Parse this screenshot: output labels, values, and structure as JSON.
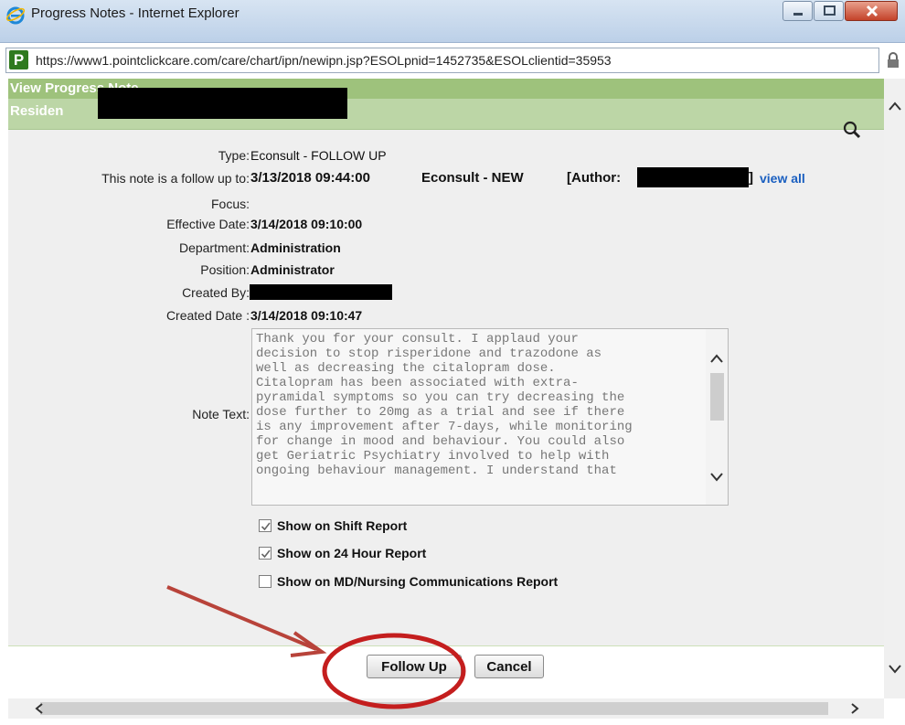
{
  "window": {
    "title": "Progress Notes - Internet Explorer",
    "url": "https://www1.pointclickcare.com/care/chart/ipn/newipn.jsp?ESOLpnid=1452735&ESOLclientid=35953"
  },
  "pane": {
    "title": "View Progress Note",
    "resident_label": "Residen"
  },
  "note": {
    "type_label": "Type:",
    "type_value": "Econsult - FOLLOW UP",
    "followup_label": "This note is a follow up to:",
    "followup_date": "3/13/2018 09:44:00",
    "followup_type": "Econsult - NEW",
    "author_label": "[Author:",
    "author_close": "]",
    "view_all": "view all",
    "focus_label": "Focus:",
    "effective_label": "Effective Date:",
    "effective_value": "3/14/2018 09:10:00",
    "department_label": "Department:",
    "department_value": "Administration",
    "position_label": "Position:",
    "position_value": "Administrator",
    "created_by_label": "Created By:",
    "created_date_label": "Created Date :",
    "created_date_value": "3/14/2018 09:10:47",
    "note_text_label": "Note Text:",
    "note_text": "Thank you for your consult. I applaud your\ndecision to stop risperidone and trazodone as\nwell as decreasing the citalopram dose.\nCitalopram has been associated with extra-\npyramidal symptoms so you can try decreasing the\ndose further to 20mg as a trial and see if there\nis any improvement after 7-days, while monitoring\nfor change in mood and behaviour. You could also\nget Geriatric Psychiatry involved to help with\nongoing behaviour management. I understand that"
  },
  "options": [
    {
      "label": "Show on Shift Report",
      "checked": true
    },
    {
      "label": "Show on 24 Hour Report",
      "checked": true
    },
    {
      "label": "Show on MD/Nursing Communications Report",
      "checked": false
    }
  ],
  "buttons": {
    "follow_up": "Follow Up",
    "cancel": "Cancel"
  },
  "colors": {
    "header_green": "#9ec27c",
    "resident_green": "#bcd6a6",
    "annotation_red": "#c41e1e",
    "arrow_red": "#b8433a",
    "link_blue": "#1a5fc0"
  }
}
